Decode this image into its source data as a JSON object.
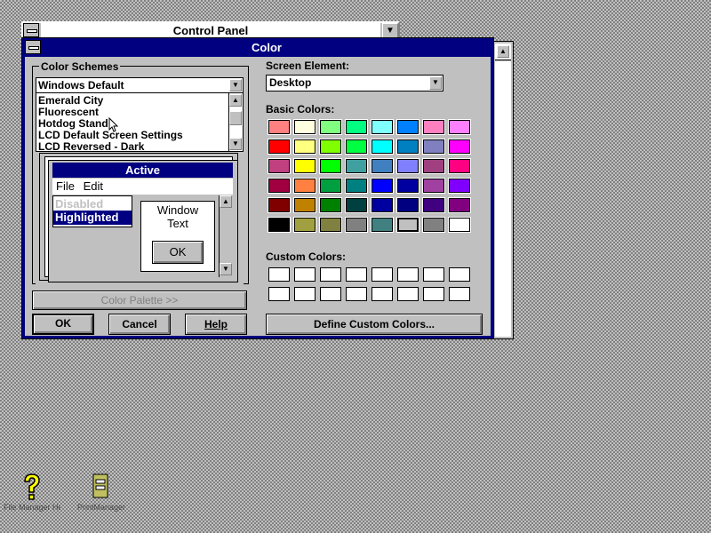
{
  "control_panel": {
    "title": "Control Panel"
  },
  "dialog": {
    "title": "Color",
    "color_schemes": {
      "group_label": "Color Schemes",
      "selected": "Windows Default",
      "items": [
        "Emerald City",
        "Fluorescent",
        "Hotdog Stand",
        "LCD Default Screen Settings",
        "LCD Reversed - Dark"
      ]
    },
    "preview": {
      "active_title": "Active",
      "menu_file": "File",
      "menu_edit": "Edit",
      "disabled_text": "Disabled",
      "highlighted_text": "Highlighted",
      "window_text_line1": "Window",
      "window_text_line2": "Text",
      "ok_label": "OK"
    },
    "color_palette_button": "Color Palette >>",
    "ok_button": "OK",
    "cancel_button": "Cancel",
    "help_button": "Help",
    "screen_element_label": "Screen Element:",
    "screen_element_value": "Desktop",
    "basic_colors_label": "Basic Colors:",
    "custom_colors_label": "Custom Colors:",
    "define_custom_colors_button": "Define Custom Colors...",
    "basic_colors": [
      [
        "#ff8080",
        "#ffffe0",
        "#80ff80",
        "#00ff80",
        "#80ffff",
        "#0080ff",
        "#ff80c0",
        "#ff80ff"
      ],
      [
        "#ff0000",
        "#ffff80",
        "#80ff00",
        "#00ff40",
        "#00ffff",
        "#0080c0",
        "#8080c0",
        "#ff00ff"
      ],
      [
        "#c04080",
        "#ffff00",
        "#00ff00",
        "#40a0a0",
        "#4080c0",
        "#8080ff",
        "#a04080",
        "#ff0080"
      ],
      [
        "#a00040",
        "#ff8040",
        "#00a040",
        "#008080",
        "#0000ff",
        "#0000a0",
        "#a040a0",
        "#8000ff"
      ],
      [
        "#800000",
        "#c08000",
        "#008000",
        "#004040",
        "#0000a0",
        "#000080",
        "#400080",
        "#800080"
      ],
      [
        "#000000",
        "#a0a040",
        "#808040",
        "#808080",
        "#408080",
        "#c0c0c0",
        "#808080",
        "#ffffff"
      ]
    ],
    "selected_basic_color": "#c0c0c0"
  },
  "desktop_icons": [
    {
      "label": "File Manager Help",
      "icon": "question-mark-icon"
    },
    {
      "label": "PrintManager",
      "icon": "printer-icon"
    }
  ]
}
